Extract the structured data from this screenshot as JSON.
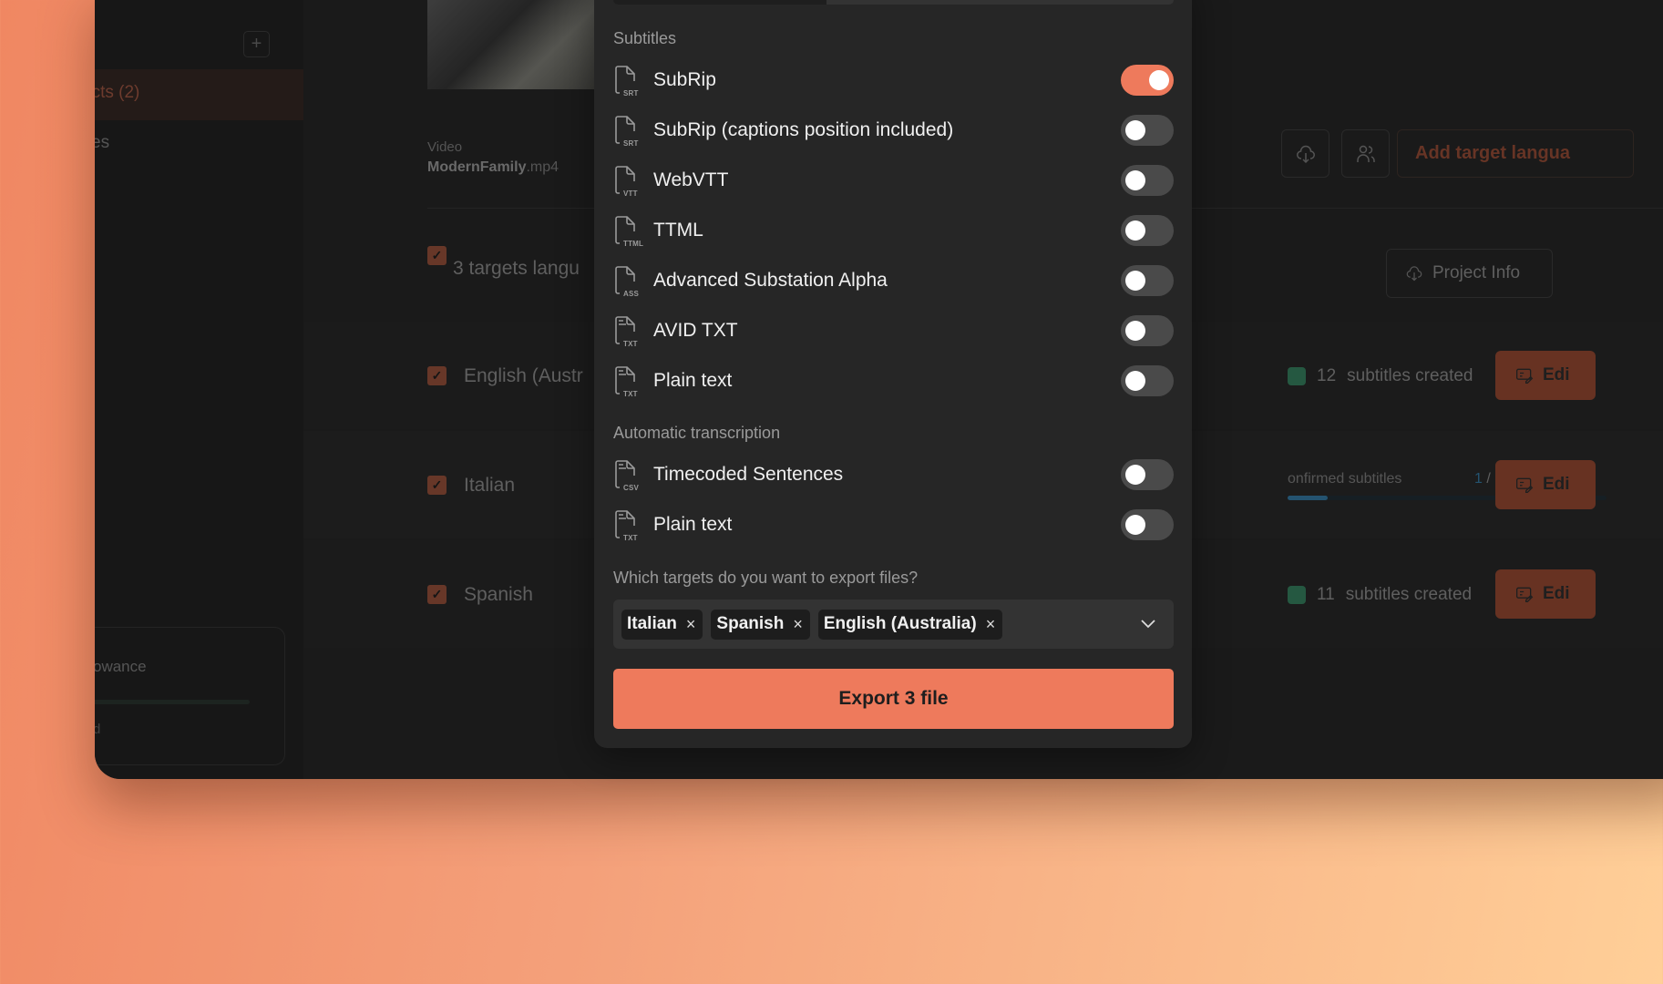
{
  "background_app": {
    "sidebar": {
      "add_button": "+",
      "nav_items": [
        {
          "label": "ects (2)",
          "active": true
        },
        {
          "label": "es",
          "active": false
        }
      ],
      "allowance_card": {
        "label": "owance",
        "sub": "d"
      }
    },
    "project": {
      "video_label": "Video",
      "video_name": "ModernFamily",
      "video_ext": ".mp4",
      "add_target_button": "Add target langua",
      "targets_summary": "3 targets langu",
      "project_info_button": "Project Info",
      "rows": [
        {
          "name": "English (Austr",
          "status_count": "12",
          "status_text": "subtitles created",
          "edit_label": "Edi"
        },
        {
          "name": "Italian",
          "progress_label": "onfirmed subtitles",
          "progress_current": "1",
          "progress_total": "/ 8",
          "progress_fraction": 0.125,
          "edit_label": "Edi"
        },
        {
          "name": "Spanish",
          "status_count": "11",
          "status_text": "subtitles created",
          "edit_label": "Edi"
        }
      ]
    }
  },
  "modal": {
    "progress_fraction": 0.38,
    "subtitles_section": "Subtitles",
    "subtitle_options": [
      {
        "label": "SubRip",
        "ext": "SRT",
        "icon": "file-icon",
        "enabled": true
      },
      {
        "label": "SubRip (captions position included)",
        "ext": "SRT",
        "icon": "file-icon",
        "enabled": false
      },
      {
        "label": "WebVTT",
        "ext": "VTT",
        "icon": "file-icon",
        "enabled": false
      },
      {
        "label": "TTML",
        "ext": "TTML",
        "icon": "file-icon",
        "enabled": false
      },
      {
        "label": "Advanced Substation Alpha",
        "ext": "ASS",
        "icon": "file-icon",
        "enabled": false
      },
      {
        "label": "AVID TXT",
        "ext": "TXT",
        "icon": "file-text-icon",
        "enabled": false
      },
      {
        "label": "Plain text",
        "ext": "TXT",
        "icon": "file-text-icon",
        "enabled": false
      }
    ],
    "transcription_section": "Automatic transcription",
    "transcription_options": [
      {
        "label": "Timecoded Sentences",
        "ext": "CSV",
        "icon": "file-text-icon",
        "enabled": false
      },
      {
        "label": "Plain text",
        "ext": "TXT",
        "icon": "file-text-icon",
        "enabled": false
      }
    ],
    "targets_question": "Which targets do you want to export files?",
    "selected_targets": [
      "Italian",
      "Spanish",
      "English (Australia)"
    ],
    "remove_glyph": "×",
    "export_button": "Export 3 file"
  },
  "colors": {
    "accent": "#ee7a5c",
    "toggle_off": "#4a4a4a",
    "modal_bg": "#262626"
  }
}
